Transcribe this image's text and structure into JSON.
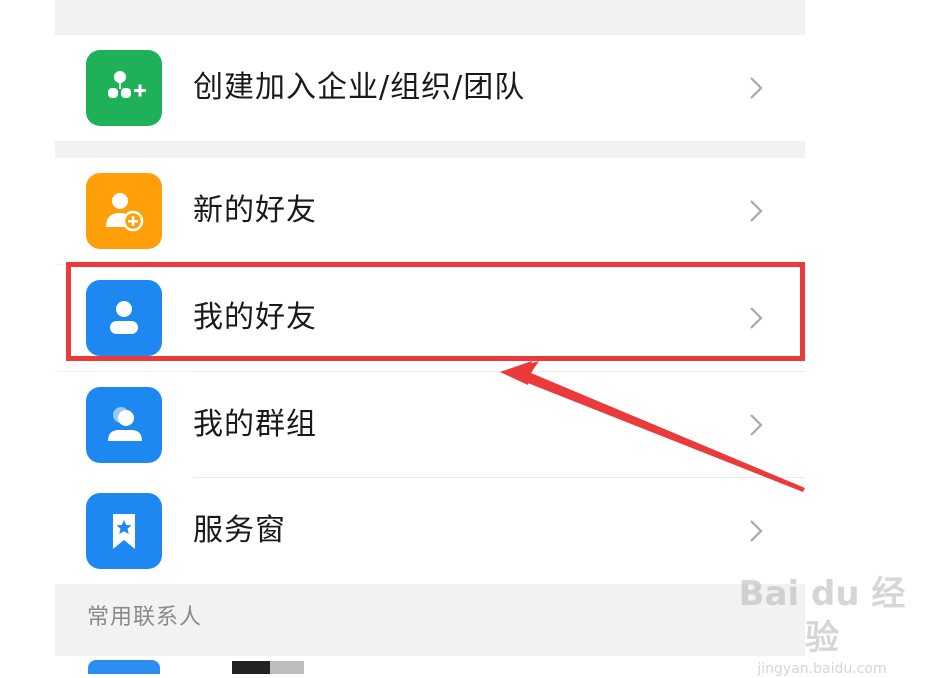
{
  "rows": [
    {
      "id": "create",
      "label": "创建加入企业/组织/团队",
      "icon": "team-add-icon",
      "color": "#1fb15a"
    },
    {
      "id": "newfriend",
      "label": "新的好友",
      "icon": "add-friend-icon",
      "color": "#ff9f0a"
    },
    {
      "id": "myfriends",
      "label": "我的好友",
      "icon": "person-icon",
      "color": "#1e88f2"
    },
    {
      "id": "mygroups",
      "label": "我的群组",
      "icon": "group-icon",
      "color": "#1e88f2"
    },
    {
      "id": "service",
      "label": "服务窗",
      "icon": "bookmark-star-icon",
      "color": "#1e88f2"
    }
  ],
  "section": {
    "frequent_contacts": "常用联系人"
  },
  "watermark": {
    "line1": "Bai du 经验",
    "line2": "jingyan.baidu.com"
  },
  "colors": {
    "highlight": "#ea3a3a",
    "arrow": "#ea3a3a"
  }
}
